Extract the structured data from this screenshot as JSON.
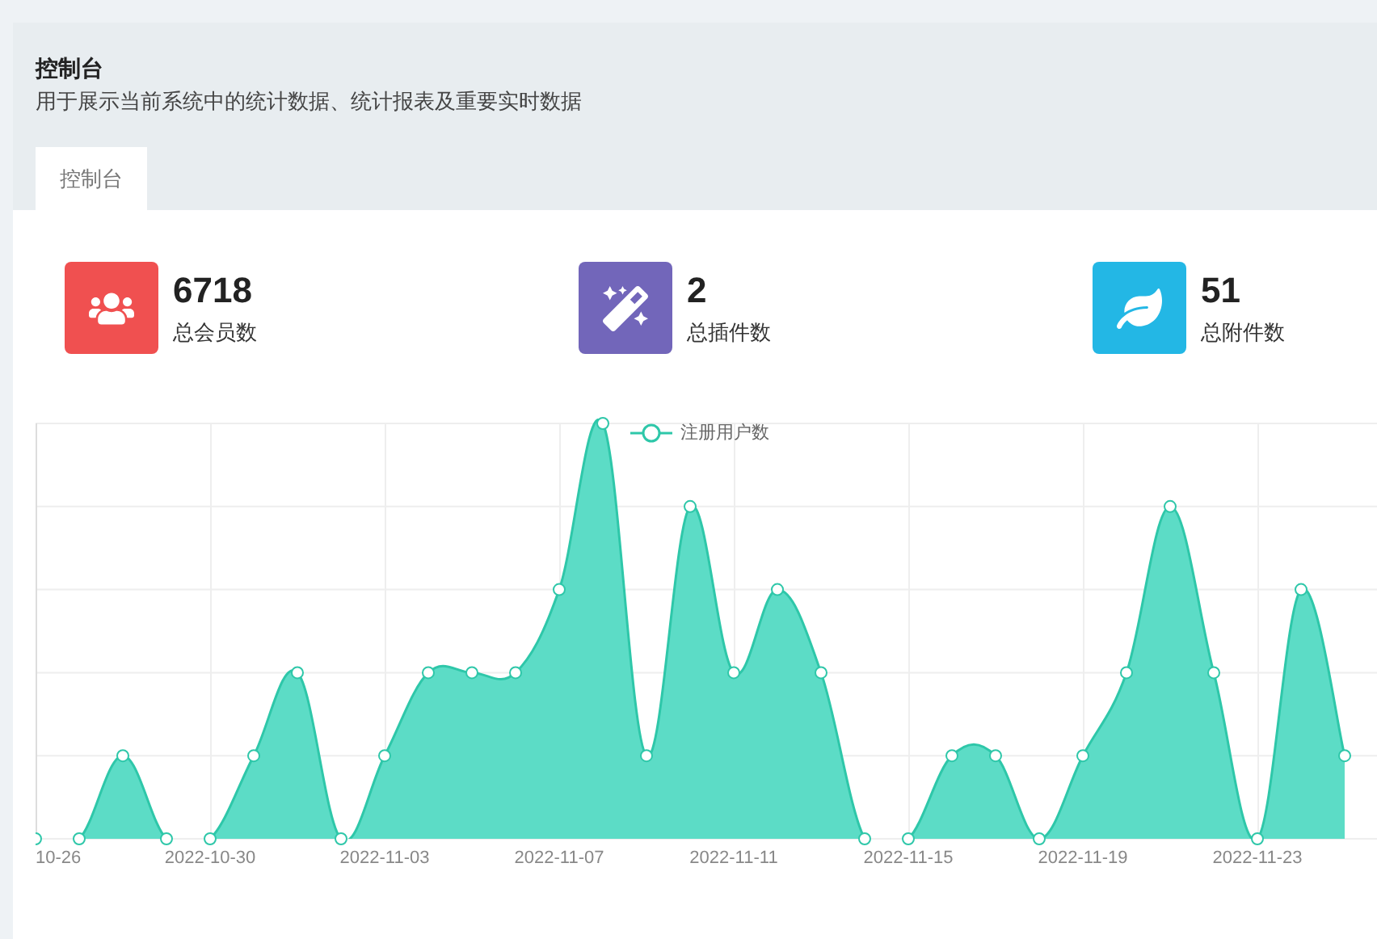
{
  "header": {
    "title": "控制台",
    "subtitle": "用于展示当前系统中的统计数据、统计报表及重要实时数据"
  },
  "tabs": [
    {
      "label": "控制台",
      "selected": true
    }
  ],
  "stats": [
    {
      "kind": "users",
      "value": "6718",
      "label": "总会员数",
      "color": "#f05050"
    },
    {
      "kind": "wand",
      "value": "2",
      "label": "总插件数",
      "color": "#7266ba"
    },
    {
      "kind": "leaf",
      "value": "51",
      "label": "总附件数",
      "color": "#23b7e5"
    }
  ],
  "chart": {
    "legend": "注册用户数",
    "x_labels": [
      "10-26",
      "2022-10-30",
      "2022-11-03",
      "2022-11-07",
      "2022-11-11",
      "2022-11-15",
      "2022-11-19",
      "2022-11-23"
    ]
  }
}
